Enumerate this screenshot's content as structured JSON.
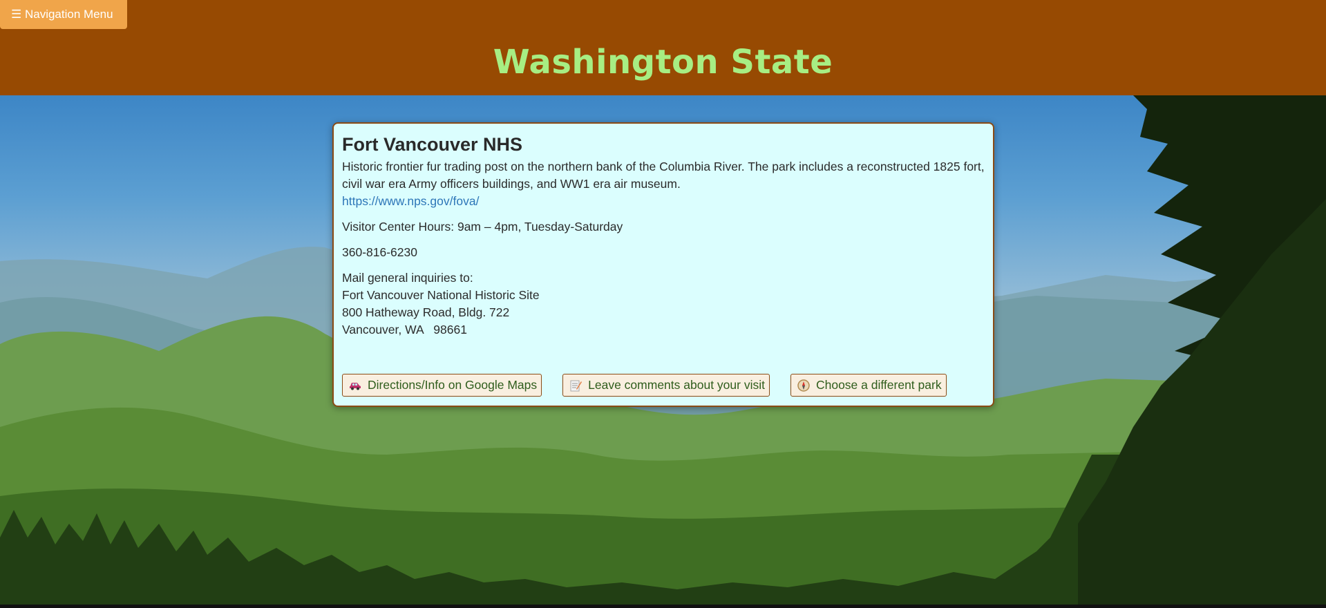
{
  "nav": {
    "toggle_icon": "hamburger-icon",
    "toggle_label": "☰ Navigation Menu"
  },
  "header": {
    "title": "Washington State"
  },
  "park": {
    "name": "Fort Vancouver NHS",
    "description": "Historic frontier fur trading post on the northern bank of the Columbia River. The park includes a reconstructed 1825 fort, civil war era Army officers buildings, and WW1 era air museum.",
    "url": "https://www.nps.gov/fova/",
    "hours": "Visitor Center Hours: 9am – 4pm, Tuesday-Saturday",
    "phone": "360-816-6230",
    "mail_heading": "Mail general inquiries to:",
    "address": [
      "Fort Vancouver National Historic Site",
      "800 Hatheway Road, Bldg. 722",
      "Vancouver, WA   98661"
    ]
  },
  "actions": {
    "directions": {
      "label": "Directions/Info on Google Maps",
      "icon": "car-icon"
    },
    "comments": {
      "label": "Leave comments about your visit",
      "icon": "memo-icon"
    },
    "choose_park": {
      "label": "Choose a different park",
      "icon": "compass-icon"
    }
  },
  "colors": {
    "header_bg": "#974a02",
    "title": "#a7ee83",
    "nav_button": "#f0a54a",
    "card_bg": "#dbfefe",
    "card_border": "#8a4a14",
    "link": "#2d76b8",
    "button_text": "#2f5d1c"
  }
}
